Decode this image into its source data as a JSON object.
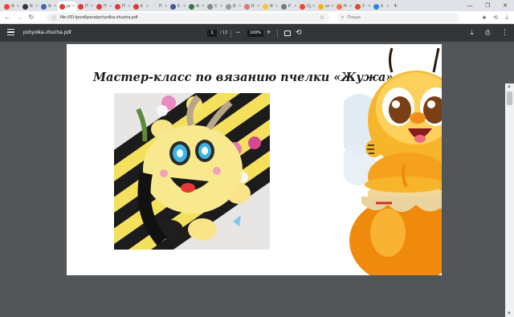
{
  "browser": {
    "tabs": [
      {
        "title": "Я",
        "color": "#ff3d2e",
        "active": false
      },
      {
        "title": "Я",
        "color": "#333333",
        "active": false
      },
      {
        "title": "Я",
        "color": "#4267b2",
        "active": false
      },
      {
        "title": "pc",
        "color": "#e53935",
        "active": true
      },
      {
        "title": "П",
        "color": "#e53935",
        "active": false
      },
      {
        "title": "П",
        "color": "#e53935",
        "active": false
      },
      {
        "title": "П",
        "color": "#e53935",
        "active": false
      },
      {
        "title": "К",
        "color": "#e53935",
        "active": false
      },
      {
        "title": "П",
        "color": "#e0e0e0",
        "active": false
      },
      {
        "title": "К",
        "color": "#3b5998",
        "active": false
      },
      {
        "title": "Al",
        "color": "#2e7d32",
        "active": false
      },
      {
        "title": "С",
        "color": "#888888",
        "active": false
      },
      {
        "title": "R",
        "color": "#999999",
        "active": false
      },
      {
        "title": "R",
        "color": "#e57373",
        "active": false
      },
      {
        "title": "Я",
        "color": "#fbc02d",
        "active": false
      },
      {
        "title": "Р",
        "color": "#777777",
        "active": false
      },
      {
        "title": "Су",
        "color": "#f44336",
        "active": false
      },
      {
        "title": "сгс",
        "color": "#f5b400",
        "active": false
      },
      {
        "title": "Н",
        "color": "#ff7043",
        "active": false
      },
      {
        "title": "У",
        "color": "#e64a19",
        "active": false
      },
      {
        "title": "Х",
        "color": "#1e88e5",
        "active": false
      }
    ],
    "tab_close": "×",
    "new_tab": "+",
    "window": {
      "minimize": "—",
      "restore": "❐",
      "close": "✕"
    },
    "address": "file:///D:/розібрати/pchyolka-zhuzha.pdf",
    "search_placeholder": "Пошук"
  },
  "pdf_toolbar": {
    "filename": "pchyolka-zhuzha.pdf",
    "current_page": "1",
    "total_pages": "/ 13",
    "zoom": "100%"
  },
  "page": {
    "heading": "Мастер-класс по вязанию пчелки «Жужа»"
  },
  "colors": {
    "tabstrip": "#dfe3e7",
    "toolbar": "#323639",
    "viewer_bg": "#525659",
    "page_bg": "#ffffff"
  }
}
